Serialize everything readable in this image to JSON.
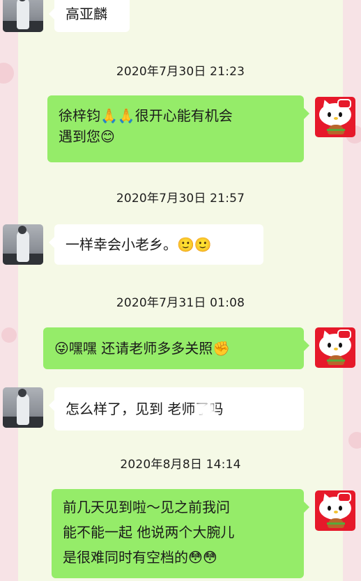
{
  "conversation": {
    "items": [
      {
        "type": "message",
        "side": "left",
        "text": "高亚麟"
      },
      {
        "type": "timestamp",
        "text": "2020年7月30日 21:23"
      },
      {
        "type": "message",
        "side": "right",
        "line1": "徐梓钧🙏🙏很开心能有机会",
        "line2": "遇到您😊"
      },
      {
        "type": "timestamp",
        "text": "2020年7月30日 21:57"
      },
      {
        "type": "message",
        "side": "left",
        "text": "一样幸会小老乡。🙂🙂"
      },
      {
        "type": "timestamp",
        "text": "2020年7月31日 01:08"
      },
      {
        "type": "message",
        "side": "right",
        "text": "😜嘿嘿 还请老师多多关照✊"
      },
      {
        "type": "message",
        "side": "left",
        "text": "怎么样了，见到  老师了吗"
      },
      {
        "type": "timestamp",
        "text": "2020年8月8日 14:14"
      },
      {
        "type": "message",
        "side": "right",
        "line1": "前几天见到啦～见之前我问",
        "line2": "能不能一起 他说两个大腕儿",
        "line3": "是很难同时有空档的😳😳"
      }
    ]
  },
  "colors": {
    "outer_background": "#f7e3e6",
    "panel_background": "#f5f9e6",
    "sent_bubble": "#95ec69",
    "received_bubble": "#ffffff"
  },
  "icons": {
    "left_avatar": "person-photo-avatar",
    "right_avatar": "hello-kitty-avatar"
  }
}
